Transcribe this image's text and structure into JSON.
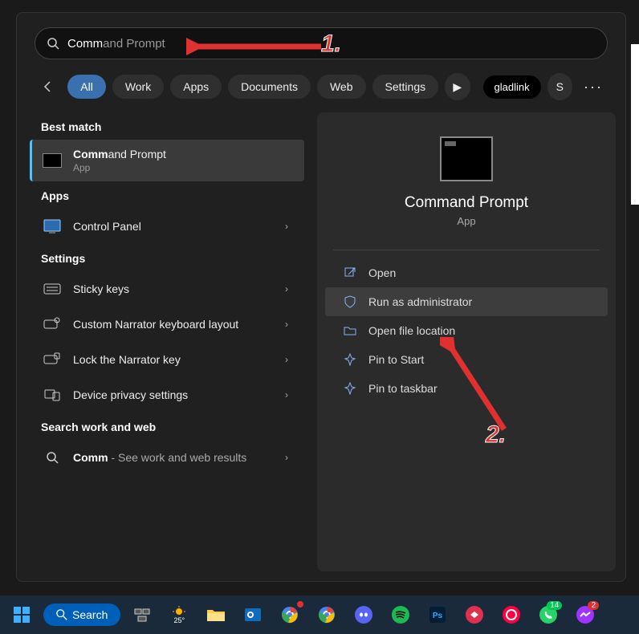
{
  "search": {
    "typed": "Comm",
    "suggestion": "and Prompt"
  },
  "filters": {
    "back_icon": "←",
    "tabs": [
      "All",
      "Work",
      "Apps",
      "Documents",
      "Web",
      "Settings"
    ],
    "play_icon": "▶",
    "extra_pill": "gladlink",
    "avatar_letter": "S",
    "more_icon": "···"
  },
  "left": {
    "best_match_header": "Best match",
    "best_match": {
      "title_prefix": "Comm",
      "title_rest": "and Prompt",
      "subtitle": "App"
    },
    "apps_header": "Apps",
    "apps": [
      {
        "title": "Control Panel"
      }
    ],
    "settings_header": "Settings",
    "settings": [
      {
        "title": "Sticky keys"
      },
      {
        "title": "Custom Narrator keyboard layout"
      },
      {
        "title": "Lock the Narrator key"
      },
      {
        "title": "Device privacy settings"
      }
    ],
    "web_header": "Search work and web",
    "web": [
      {
        "title_prefix": "Comm",
        "title_rest": " - See work and web results"
      }
    ]
  },
  "preview": {
    "title": "Command Prompt",
    "subtitle": "App",
    "actions": [
      {
        "id": "open",
        "label": "Open",
        "icon": "open"
      },
      {
        "id": "run-admin",
        "label": "Run as administrator",
        "icon": "shield",
        "highlight": true
      },
      {
        "id": "open-loc",
        "label": "Open file location",
        "icon": "folder"
      },
      {
        "id": "pin-start",
        "label": "Pin to Start",
        "icon": "pin"
      },
      {
        "id": "pin-taskbar",
        "label": "Pin to taskbar",
        "icon": "pin"
      }
    ]
  },
  "annotations": {
    "step1": "1.",
    "step2": "2."
  },
  "taskbar": {
    "search_label": "Search",
    "temp": "25°",
    "icons": [
      {
        "name": "task-view"
      },
      {
        "name": "weather"
      },
      {
        "name": "file-explorer"
      },
      {
        "name": "outlook"
      },
      {
        "name": "chrome-a",
        "badge": ""
      },
      {
        "name": "chrome-b"
      },
      {
        "name": "discord"
      },
      {
        "name": "spotify"
      },
      {
        "name": "photoshop"
      },
      {
        "name": "app-red"
      },
      {
        "name": "app-circle"
      },
      {
        "name": "whatsapp",
        "badge": "14",
        "badge_color": "green"
      },
      {
        "name": "messenger",
        "badge": "2"
      }
    ]
  },
  "colors": {
    "accent": "#4cc2ff",
    "annotation": "#e03030"
  }
}
